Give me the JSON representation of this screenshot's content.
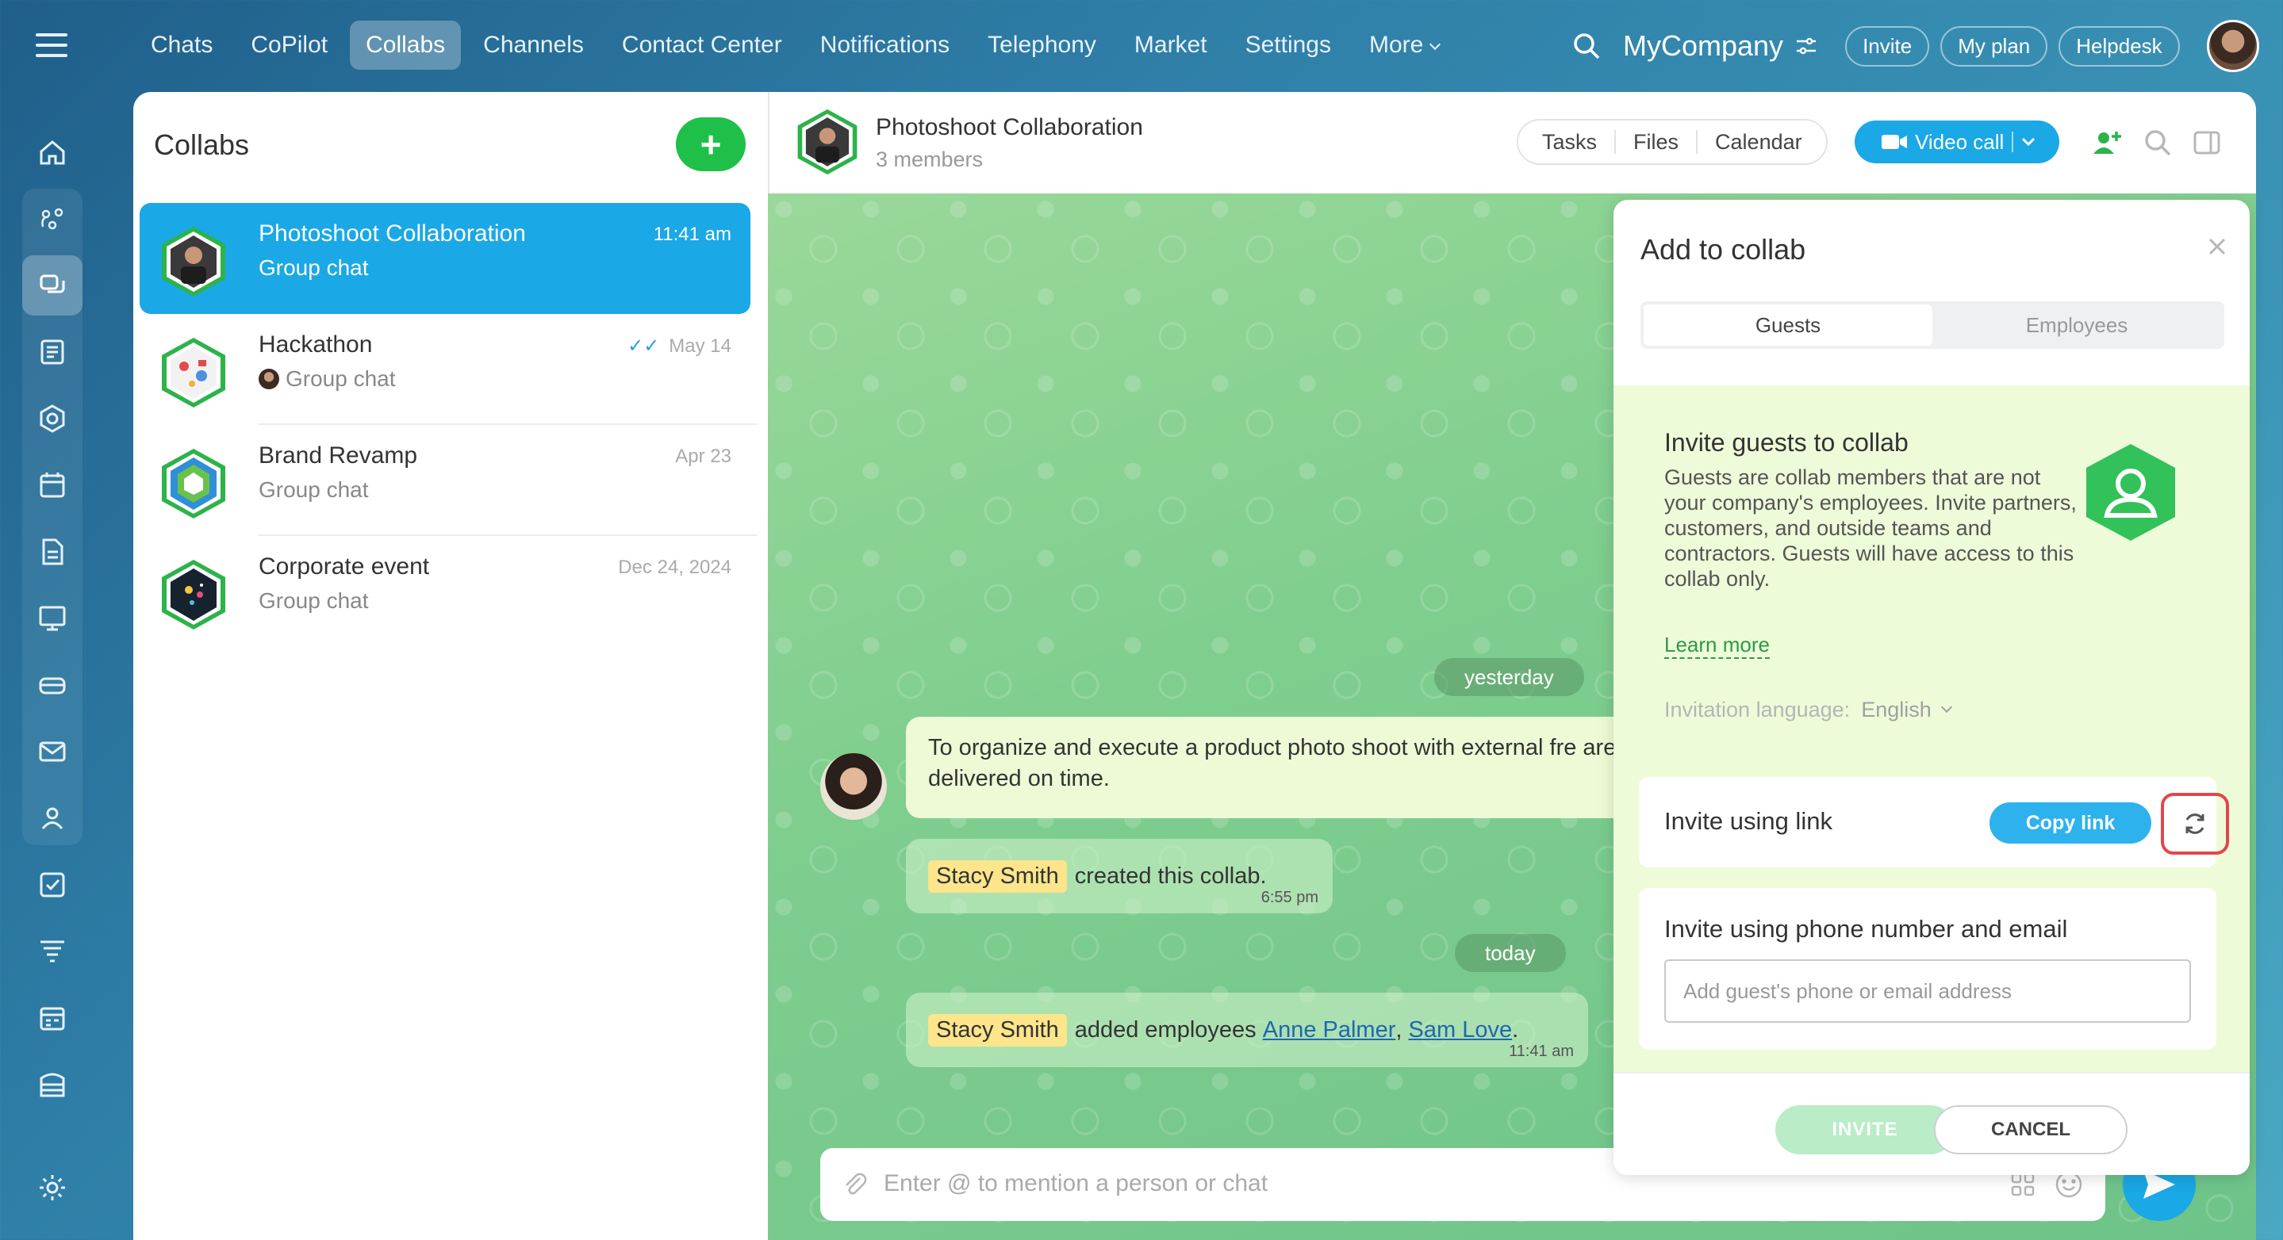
{
  "nav": {
    "items": [
      "Chats",
      "CoPilot",
      "Collabs",
      "Channels",
      "Contact Center",
      "Notifications",
      "Telephony",
      "Market",
      "Settings",
      "More"
    ],
    "active": "Collabs"
  },
  "topbar": {
    "company": "MyCompany",
    "invite_label": "Invite",
    "plan_label": "My plan",
    "helpdesk_label": "Helpdesk"
  },
  "rail": {
    "icons": [
      "home-icon",
      "copilot-icon",
      "collabs-icon",
      "feed-icon",
      "groups-icon",
      "calendar-icon",
      "docs-icon",
      "boards-icon",
      "drive-icon",
      "mail-icon",
      "contacts-icon",
      "tasks-icon",
      "crm-icon",
      "schedule-icon",
      "sites-icon",
      "settings-icon"
    ],
    "active": "collabs-icon"
  },
  "collabs": {
    "title": "Collabs",
    "items": [
      {
        "name": "Photoshoot Collaboration",
        "sub": "Group chat",
        "time": "11:41 am"
      },
      {
        "name": "Hackathon",
        "sub": "Group chat",
        "time": "May 14"
      },
      {
        "name": "Brand Revamp",
        "sub": "Group chat",
        "time": "Apr 23"
      },
      {
        "name": "Corporate event",
        "sub": "Group chat",
        "time": "Dec 24, 2024"
      }
    ]
  },
  "chat": {
    "title": "Photoshoot Collaboration",
    "members": "3 members",
    "tabs": [
      "Tasks",
      "Files",
      "Calendar"
    ],
    "video_label": "Video call",
    "date_yesterday": "yesterday",
    "date_today": "today",
    "message_text": "To organize and execute a product photo shoot with external fre are delivered on time.",
    "sys1": {
      "name": "Stacy Smith",
      "text": "created this collab.",
      "time": "6:55 pm"
    },
    "sys2": {
      "name": "Stacy Smith",
      "text": "added employees",
      "emp1": "Anne Palmer",
      "sep": ",",
      "emp2": "Sam Love",
      "end": ".",
      "time": "11:41 am"
    },
    "composer_placeholder": "Enter @ to mention a person or chat"
  },
  "panel": {
    "title": "Add to collab",
    "seg_guests": "Guests",
    "seg_employees": "Employees",
    "invite_title": "Invite guests to collab",
    "invite_desc": "Guests are collab members that are not your company's employees. Invite partners, customers, and outside teams and contractors. Guests will have access to this collab only.",
    "learn_more": "Learn more",
    "lang_label": "Invitation language:",
    "lang_value": "English",
    "link_label": "Invite using link",
    "copy_link": "Copy link",
    "phone_label": "Invite using phone number and email",
    "guest_placeholder": "Add guest's phone or email address",
    "invite_btn": "INVITE",
    "cancel_btn": "CANCEL"
  },
  "colors": {
    "accent": "#1aa8e6",
    "green": "#1fc04a",
    "highlight": "#e2474b"
  }
}
